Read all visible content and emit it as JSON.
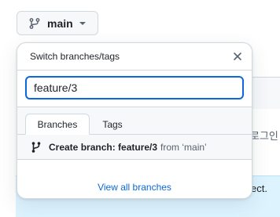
{
  "branch_button": {
    "label": "main",
    "icon": "git-branch-icon"
  },
  "background": {
    "right_text_korean": "로그인",
    "right_text_lower": "ect."
  },
  "dropdown": {
    "title": "Switch branches/tags",
    "close_icon": "close-icon",
    "filter": {
      "value": "feature/3",
      "placeholder": ""
    },
    "tabs": [
      {
        "label": "Branches",
        "selected": true
      },
      {
        "label": "Tags",
        "selected": false
      }
    ],
    "create_branch": {
      "icon": "git-branch-icon",
      "label": "Create branch: feature/3",
      "from_text": "from ‘main’"
    },
    "footer_link": "View all branches"
  },
  "colors": {
    "accent": "#0969da",
    "border": "#d1d9e0",
    "muted_bg": "#f6f8fa",
    "banner_bg": "#ddf4ff"
  }
}
